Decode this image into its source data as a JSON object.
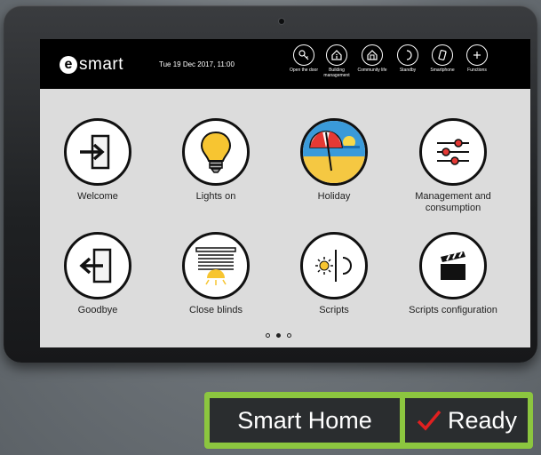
{
  "app": {
    "logo_letter": "e",
    "logo_text": "smart",
    "datetime": "Tue 19 Dec 2017, 11:00"
  },
  "top_actions": [
    {
      "label": "Open the door",
      "icon": "key-icon"
    },
    {
      "label": "Building management",
      "icon": "building-icon"
    },
    {
      "label": "Community life",
      "icon": "community-house-icon"
    },
    {
      "label": "Standby",
      "icon": "moon-icon"
    },
    {
      "label": "Smartphone",
      "icon": "smartphone-icon"
    },
    {
      "label": "Functions",
      "icon": "plus-icon"
    }
  ],
  "tiles": [
    {
      "label": "Welcome",
      "icon": "enter-door-icon"
    },
    {
      "label": "Lights on",
      "icon": "lightbulb-icon"
    },
    {
      "label": "Holiday",
      "icon": "beach-umbrella-icon"
    },
    {
      "label": "Management and consumption",
      "icon": "sliders-icon"
    },
    {
      "label": "Goodbye",
      "icon": "exit-door-icon"
    },
    {
      "label": "Close blinds",
      "icon": "blinds-icon"
    },
    {
      "label": "Scripts",
      "icon": "sun-moon-icon"
    },
    {
      "label": "Scripts configuration",
      "icon": "clapperboard-icon"
    }
  ],
  "pagination": {
    "current": 2,
    "total": 3
  },
  "badges": {
    "smart_home": "Smart Home",
    "ready": "Ready"
  },
  "colors": {
    "accent_green": "#8cc63f",
    "check_red": "#e02020",
    "bulb_yellow": "#f7c531",
    "sky_blue": "#3a9ad9",
    "sand": "#f5c842"
  }
}
